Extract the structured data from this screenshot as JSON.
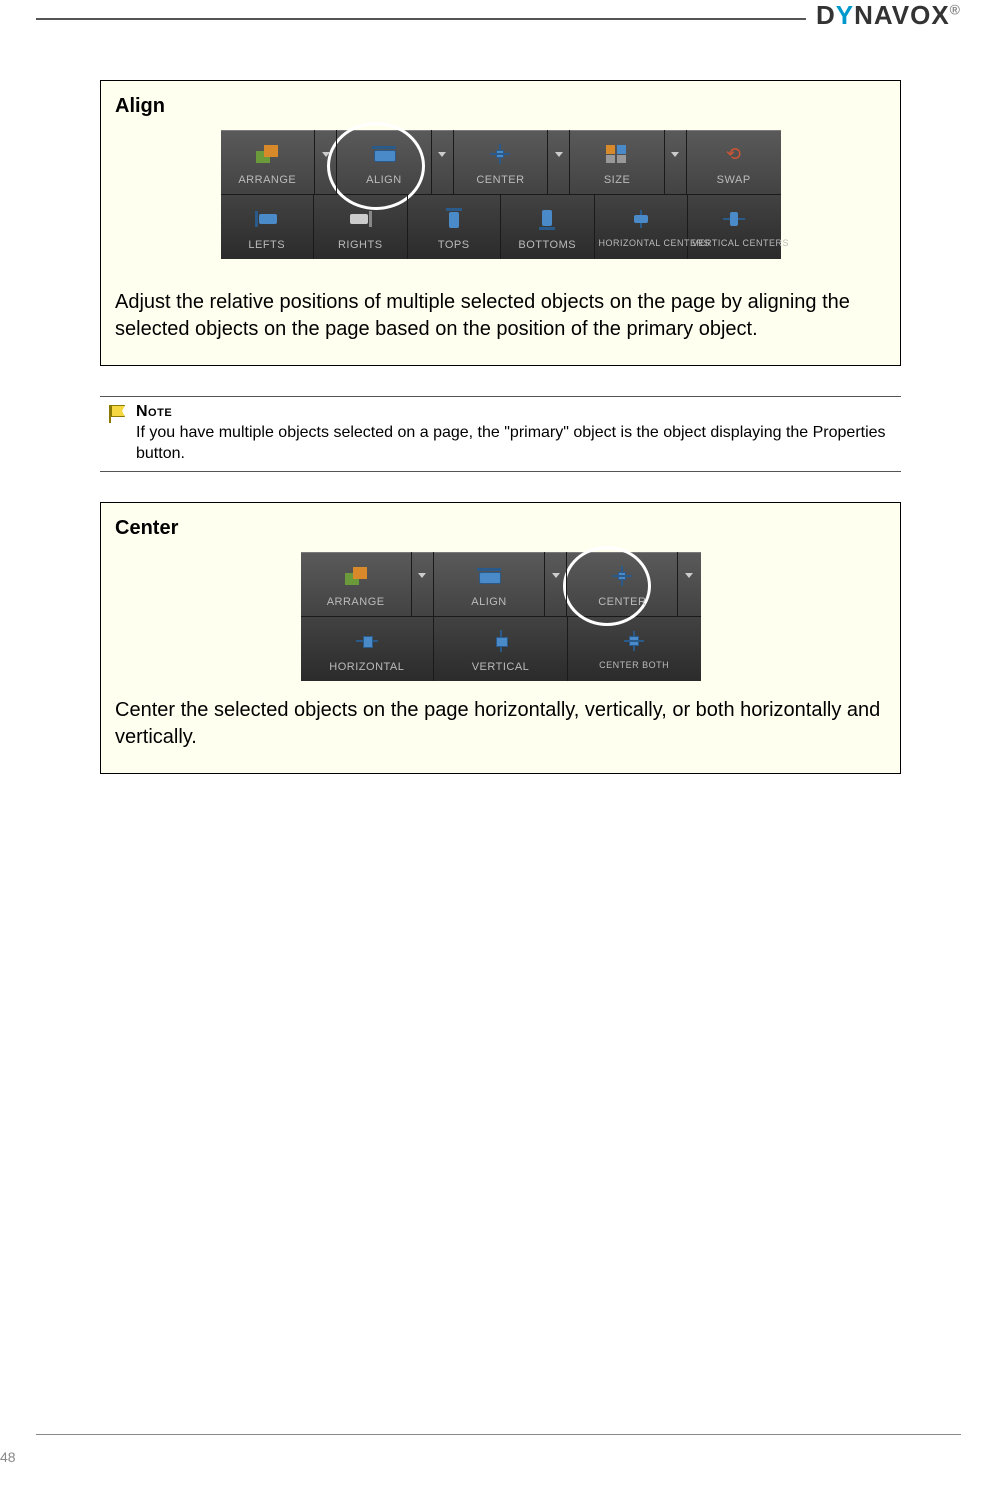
{
  "brand": {
    "pre": "D",
    "accent": "Y",
    "post": "NAVOX"
  },
  "page_number": "48",
  "align_section": {
    "title": "Align",
    "description": "Adjust the relative positions of multiple selected objects on the page by aligning the selected objects on the page based on the position of the primary object.",
    "top_row": [
      "ARRANGE",
      "ALIGN",
      "CENTER",
      "SIZE",
      "SWAP"
    ],
    "bottom_row": [
      "LEFTS",
      "RIGHTS",
      "TOPS",
      "BOTTOMS",
      "HORIZONTAL CENTERS",
      "VERTICAL CENTERS"
    ]
  },
  "note": {
    "title": "Note",
    "body": "If you have multiple objects selected on a page, the \"primary\" object is the object displaying the Properties button."
  },
  "center_section": {
    "title": "Center",
    "description": "Center the selected objects on the page horizontally, vertically, or both horizontally and vertically.",
    "top_row": [
      "ARRANGE",
      "ALIGN",
      "CENTER"
    ],
    "bottom_row": [
      "HORIZONTAL",
      "VERTICAL",
      "CENTER BOTH"
    ]
  }
}
